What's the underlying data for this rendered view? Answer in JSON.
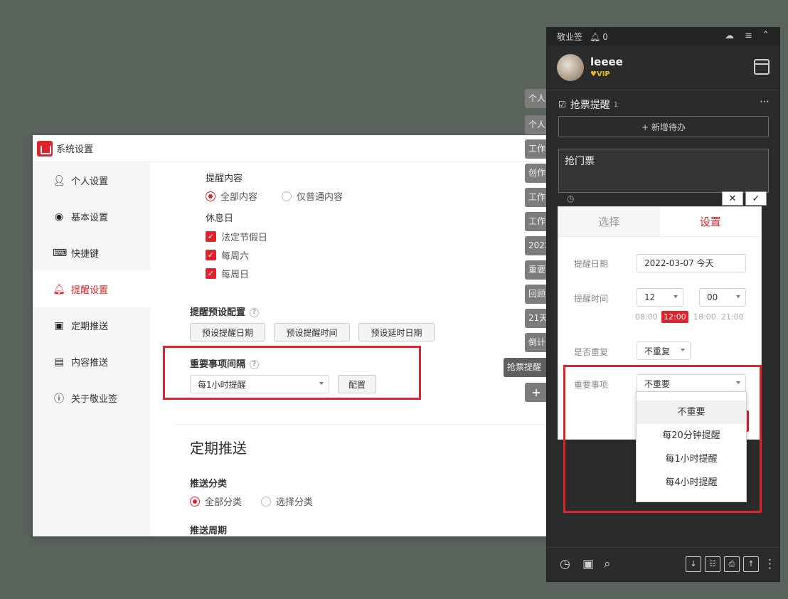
{
  "settings": {
    "title": "系统设置",
    "sidebar": [
      {
        "label": "个人设置",
        "icon": "user-icon"
      },
      {
        "label": "基本设置",
        "icon": "circle-dot-icon"
      },
      {
        "label": "快捷键",
        "icon": "keyboard-icon"
      },
      {
        "label": "提醒设置",
        "icon": "bell-icon"
      },
      {
        "label": "定期推送",
        "icon": "push-icon"
      },
      {
        "label": "内容推送",
        "icon": "document-icon"
      },
      {
        "label": "关于敬业签",
        "icon": "info-icon"
      }
    ],
    "content": {
      "reminder_content_label": "提醒内容",
      "radio_all": "全部内容",
      "radio_plain": "仅普通内容",
      "holiday_label": "休息日",
      "check_holiday": "法定节假日",
      "check_sat": "每周六",
      "check_sun": "每周日",
      "preset_title": "提醒预设配置",
      "preset_btn_date": "预设提醒日期",
      "preset_btn_time": "预设提醒时间",
      "preset_btn_delay": "预设延时日期",
      "important_title": "重要事项间隔",
      "important_value": "每1小时提醒",
      "config_btn": "配置",
      "periodic_heading": "定期推送",
      "push_category_label": "推送分类",
      "radio_all_cat": "全部分类",
      "radio_select_cat": "选择分类",
      "push_cycle_label": "推送周期"
    }
  },
  "side_tabs": [
    "个人",
    "个人",
    "工作",
    "创作",
    "工作",
    "工作",
    "2022",
    "重要",
    "回顾",
    "21天",
    "倒计",
    "抢票提醒",
    "+"
  ],
  "panel": {
    "app_name": "敬业签",
    "bell_count": "0",
    "username": "leeee",
    "vip": "VIP",
    "section_title": "抢票提醒",
    "section_count": "1",
    "new_todo": "+ 新增待办",
    "todo_text": "抢门票",
    "cancel_glyph": "✕",
    "confirm_glyph": "✓",
    "popup": {
      "tab_select": "选择",
      "tab_settings": "设置",
      "date_label": "提醒日期",
      "date_value": "2022-03-07  今天",
      "time_label": "提醒时间",
      "hour_value": "12",
      "minute_value": "00",
      "quick_times": [
        "08:00",
        "12:00",
        "18:00",
        "21:00"
      ],
      "repeat_label": "是否重复",
      "repeat_value": "不重复",
      "important_label": "重要事项",
      "important_value": "不重要"
    },
    "dropdown_options": [
      "不重要",
      "每20分钟提醒",
      "每1小时提醒",
      "每4小时提醒"
    ]
  },
  "colors": {
    "accent": "#e0232a",
    "panel_bg": "#2a2c2b",
    "desktop_bg": "#59635b"
  }
}
